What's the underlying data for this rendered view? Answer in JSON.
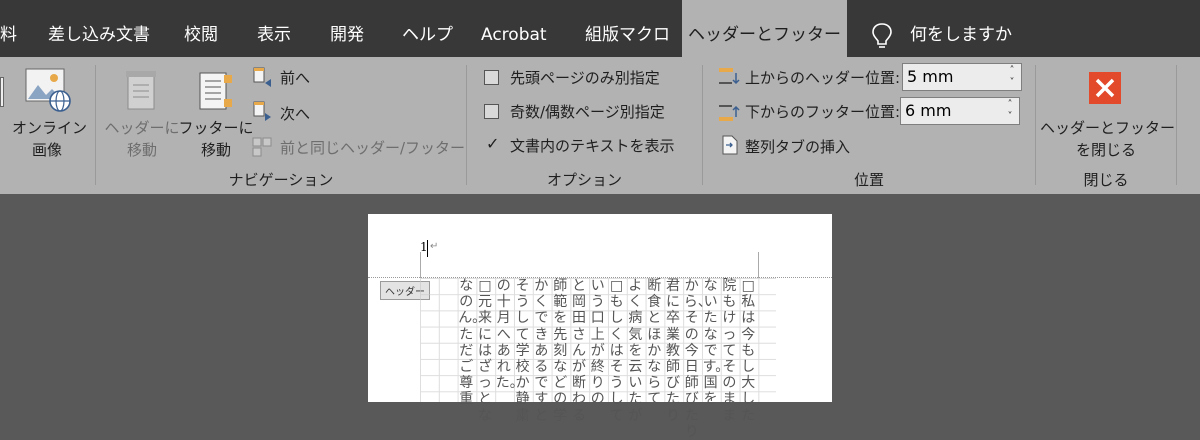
{
  "tabs": [
    {
      "label": "料"
    },
    {
      "label": "差し込み文書"
    },
    {
      "label": "校閲"
    },
    {
      "label": "表示"
    },
    {
      "label": "開発"
    },
    {
      "label": "ヘルプ"
    },
    {
      "label": "Acrobat"
    },
    {
      "label": "組版マクロ"
    },
    {
      "label": "ヘッダーとフッター",
      "active": true
    }
  ],
  "tell_me": "何をしますか",
  "ribbon": {
    "insert": {
      "online_image_line1": "オンライン",
      "online_image_line2": "画像"
    },
    "navigation": {
      "goto_header_line1": "ヘッダーに",
      "goto_header_line2": "移動",
      "goto_footer_line1": "フッターに",
      "goto_footer_line2": "移動",
      "prev": "前へ",
      "next": "次へ",
      "link_prev": "前と同じヘッダー/フッター",
      "label": "ナビゲーション"
    },
    "options": {
      "diff_first": "先頭ページのみ別指定",
      "diff_first_checked": false,
      "diff_odd_even": "奇数/偶数ページ別指定",
      "diff_odd_even_checked": false,
      "show_text": "文書内のテキストを表示",
      "show_text_checked": true,
      "label": "オプション"
    },
    "position": {
      "header_pos_label": "上からのヘッダー位置:",
      "header_pos_value": "5 mm",
      "footer_pos_label": "下からのフッター位置:",
      "footer_pos_value": "6 mm",
      "insert_tab": "整列タブの挿入",
      "label": "位置"
    },
    "close": {
      "line1": "ヘッダーとフッター",
      "line2": "を閉じる",
      "label": "閉じる"
    }
  },
  "document": {
    "header_tag": "ヘッダー",
    "page_number": "1",
    "columns": [
      "□私は今もし大した",
      "院もけってそのまま",
      "ないたなです。国を",
      "から、その今日師びたり",
      "君に卒業教師びたり",
      "断食とほかならて",
      "よく病気を云いたが",
      "□もしくはそうして",
      "いう口上が終りの",
      "と岡田さんが断わる",
      "師範を先刻などの学",
      "かくできあるですと",
      "そうして学校か静粛",
      "の十月へあれた。",
      "□元来にはざっとな",
      "なのん。ただご尊重"
    ]
  },
  "colors": {
    "accent_close": "#e34a2b",
    "tabbar": "#383838",
    "ribbon": "#b2b2b2"
  }
}
